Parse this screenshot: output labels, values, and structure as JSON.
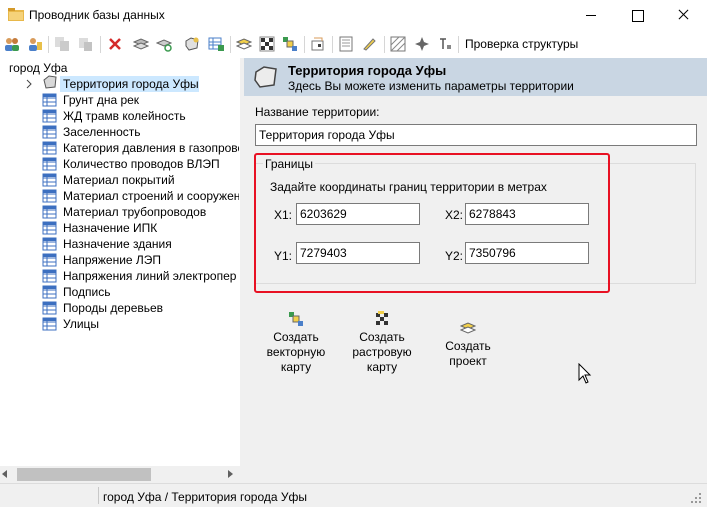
{
  "window": {
    "title": "Проводник базы данных"
  },
  "toolbar": {
    "buttons": [
      {
        "icon": "users-icon"
      },
      {
        "icon": "user-key-icon"
      },
      {
        "icon": "copy-disabled-icon"
      },
      {
        "icon": "paste-disabled-icon"
      },
      {
        "icon": "delete-icon"
      },
      {
        "icon": "layers-stack-icon"
      },
      {
        "icon": "layers-refresh-icon"
      },
      {
        "icon": "territory-icon"
      },
      {
        "icon": "table-add-icon"
      },
      {
        "icon": "layers-yellow-icon"
      },
      {
        "icon": "raster-icon"
      },
      {
        "icon": "vector-map-icon"
      },
      {
        "icon": "import-icon"
      },
      {
        "icon": "properties-icon"
      },
      {
        "icon": "edit-icon"
      },
      {
        "icon": "hatch-icon"
      },
      {
        "icon": "crosshair-icon"
      },
      {
        "icon": "text-cursor-icon"
      }
    ],
    "check_structure": "Проверка структуры"
  },
  "tree": {
    "root": "город Уфа",
    "selected": "Территория города Уфы",
    "items": [
      "Грунт дна рек",
      "ЖД трамв колейность",
      "Заселенность",
      "Категория давления в газопрово",
      "Количество проводов ВЛЭП",
      "Материал покрытий",
      "Материал строений и сооружен",
      "Материал трубопроводов",
      "Назначение ИПК",
      "Назначение здания",
      "Напряжение ЛЭП",
      "Напряжения линий электропер",
      "Подпись",
      "Породы деревьев",
      "Улицы"
    ]
  },
  "header": {
    "title": "Территория города Уфы",
    "subtitle": "Здесь Вы можете изменить параметры территории"
  },
  "form": {
    "name_label": "Название территории:",
    "name_value": "Территория города Уфы",
    "bounds": {
      "title": "Границы",
      "hint": "Задайте координаты границ территории в метрах",
      "x1_label": "X1:",
      "x1": "6203629",
      "x2_label": "X2:",
      "x2": "6278843",
      "y1_label": "Y1:",
      "y1": "7279403",
      "y2_label": "Y2:",
      "y2": "7350796"
    }
  },
  "actions": {
    "vector": [
      "Создать",
      "векторную",
      "карту"
    ],
    "raster": [
      "Создать",
      "растровую",
      "карту"
    ],
    "project": [
      "Создать",
      "проект"
    ]
  },
  "status": {
    "path": "город Уфа / Территория города Уфы"
  },
  "colors": {
    "header_bg": "#c9d6e3",
    "selection": "#cce8ff",
    "highlight": "#e81123"
  }
}
